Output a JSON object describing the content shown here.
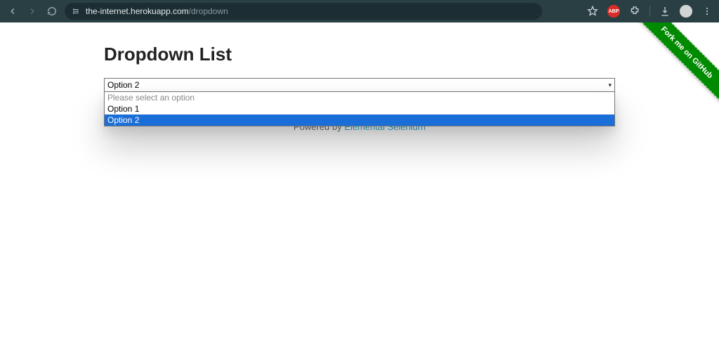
{
  "browser": {
    "url_domain": "the-internet.herokuapp.com",
    "url_path": "/dropdown",
    "abp_label": "ABP"
  },
  "ribbon": {
    "text": "Fork me on GitHub"
  },
  "page": {
    "title": "Dropdown List"
  },
  "dropdown": {
    "selected": "Option 2",
    "options": [
      {
        "label": "Please select an option",
        "disabled": true,
        "highlight": false
      },
      {
        "label": "Option 1",
        "disabled": false,
        "highlight": false
      },
      {
        "label": "Option 2",
        "disabled": false,
        "highlight": true
      }
    ]
  },
  "footer": {
    "prefix": "Powered by ",
    "link": "Elemental Selenium"
  }
}
